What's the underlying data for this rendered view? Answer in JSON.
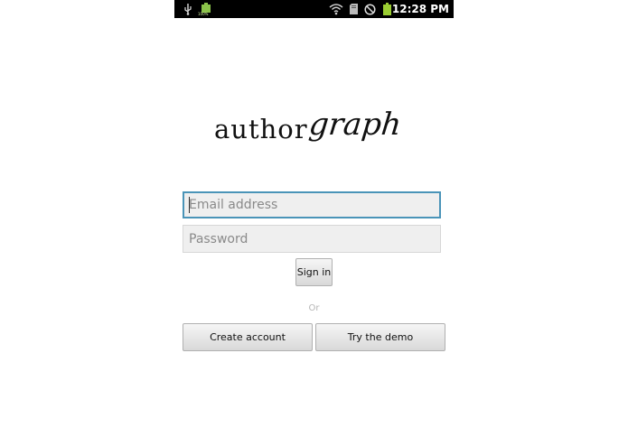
{
  "status_bar": {
    "time": "12:28 PM",
    "left_icons": [
      "usb-icon",
      "battery-full-notification-icon"
    ],
    "right_icons": [
      "wifi-icon",
      "sd-card-icon",
      "no-sim-icon",
      "battery-icon"
    ],
    "battery_notification_text": "100%"
  },
  "logo": {
    "part1": "author",
    "part2": "graph"
  },
  "form": {
    "email_placeholder": "Email address",
    "password_placeholder": "Password",
    "sign_in_label": "Sign in",
    "or_text": "Or",
    "create_account_label": "Create account",
    "try_demo_label": "Try the demo"
  },
  "colors": {
    "status_bar": "#000000",
    "focus_border": "#4a94b8",
    "battery": "#9acd32"
  }
}
